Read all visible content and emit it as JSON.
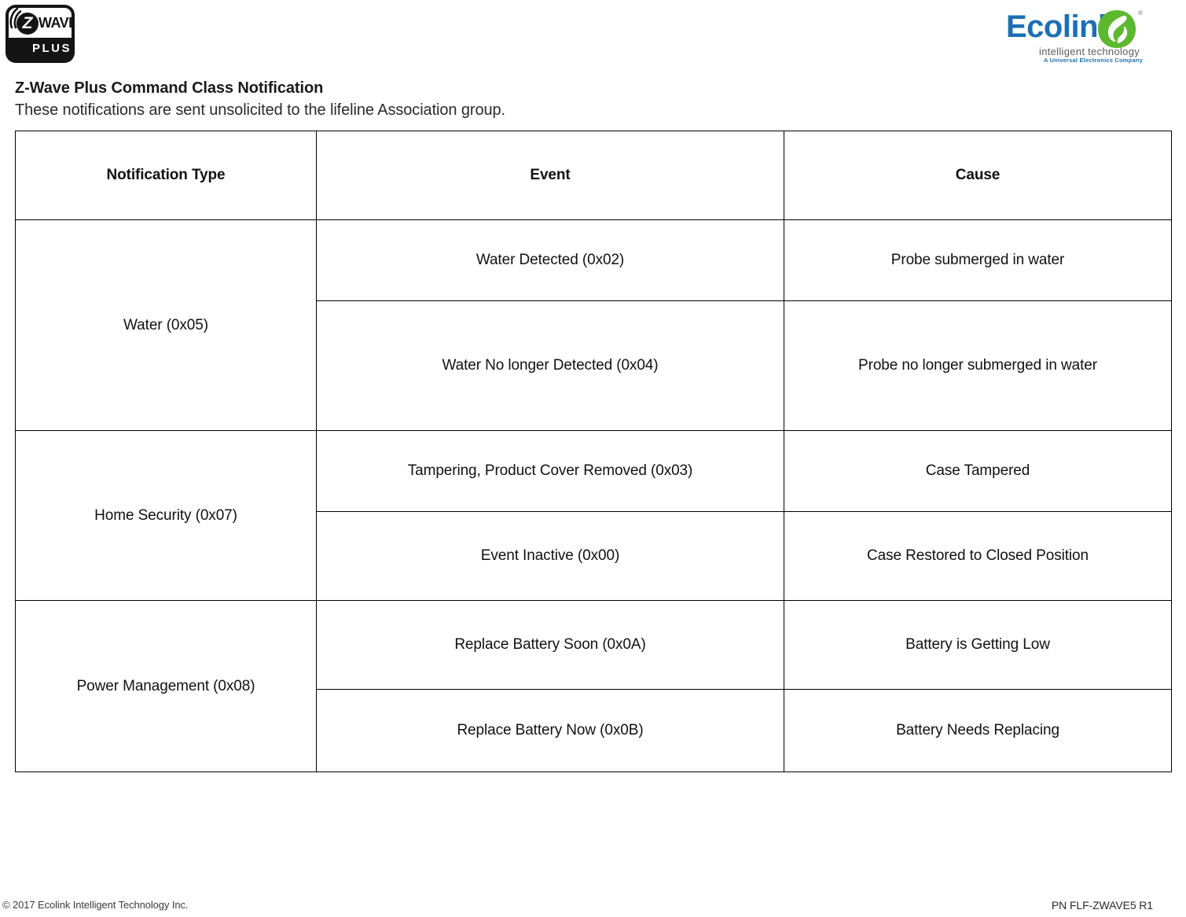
{
  "header": {
    "zwave_logo": {
      "mark": "Z",
      "wave_text": "WAVE",
      "plus_text": "PLUS",
      "alt": "Z-Wave Plus certified logo"
    },
    "ecolink_logo": {
      "wordmark": "Ecolink",
      "registered_mark": "®",
      "tagline": "intelligent technology",
      "subtagline": "A Universal Electronics Company",
      "brand_blue": "#1c6fb5",
      "leaf_green": "#5cb82e"
    }
  },
  "intro": {
    "title": "Z-Wave Plus Command Class Notification",
    "subtitle": "These notifications are sent unsolicited to the lifeline Association group."
  },
  "table": {
    "columns": [
      "Notification Type",
      "Event",
      "Cause"
    ],
    "groups": [
      {
        "type": "Water (0x05)",
        "rows": [
          {
            "event": "Water Detected (0x02)",
            "cause": "Probe submerged in water"
          },
          {
            "event": "Water No longer Detected (0x04)",
            "cause": "Probe no longer submerged in water"
          }
        ]
      },
      {
        "type": "Home Security (0x07)",
        "rows": [
          {
            "event": "Tampering, Product Cover Removed (0x03)",
            "cause": "Case Tampered"
          },
          {
            "event": "Event Inactive (0x00)",
            "cause": "Case Restored to Closed Position"
          }
        ]
      },
      {
        "type": "Power Management (0x08)",
        "rows": [
          {
            "event": "Replace Battery Soon (0x0A)",
            "cause": "Battery is Getting Low"
          },
          {
            "event": "Replace Battery Now (0x0B)",
            "cause": "Battery Needs Replacing"
          }
        ]
      }
    ]
  },
  "footer": {
    "copyright": "© 2017 Ecolink Intelligent Technology Inc.",
    "part_number": "PN FLF-ZWAVE5 R1"
  }
}
